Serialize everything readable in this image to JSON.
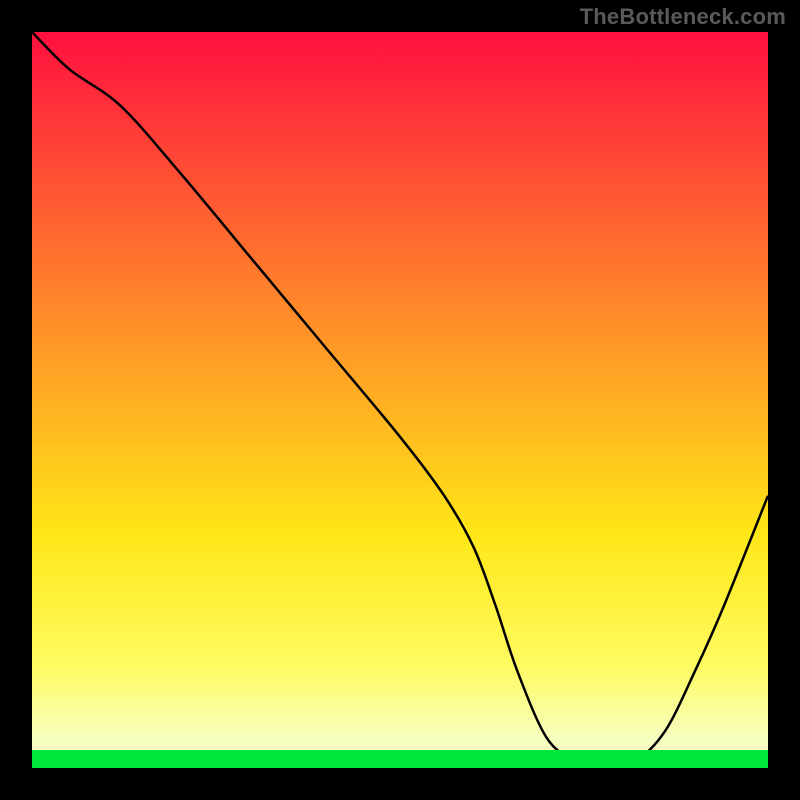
{
  "watermark": {
    "text": "TheBottleneck.com"
  },
  "colors": {
    "frame": "#000000",
    "grad_top": "#ff103f",
    "grad_mid": "#ff8a2a",
    "grad_low": "#ffe617",
    "grad_yellow": "#fffb60",
    "grad_pale": "#f6ffbf",
    "green": "#00e63a",
    "curve": "#000000",
    "sweet_spot": "#cc5a5a"
  },
  "chart_data": {
    "type": "line",
    "title": "",
    "xlabel": "",
    "ylabel": "",
    "xlim": [
      0,
      100
    ],
    "ylim": [
      0,
      100
    ],
    "series": [
      {
        "name": "bottleneck-curve",
        "x": [
          0,
          5,
          12,
          20,
          30,
          40,
          50,
          56,
          60,
          63,
          66,
          70,
          74,
          78,
          82,
          86,
          90,
          94,
          100
        ],
        "y": [
          100,
          95,
          90,
          81,
          69,
          57,
          45,
          37,
          30,
          22,
          13,
          4,
          1,
          0.5,
          1,
          5,
          13,
          22,
          37
        ]
      }
    ],
    "sweet_spot": {
      "x_start": 68,
      "x_end": 84,
      "y": 1.2
    }
  }
}
